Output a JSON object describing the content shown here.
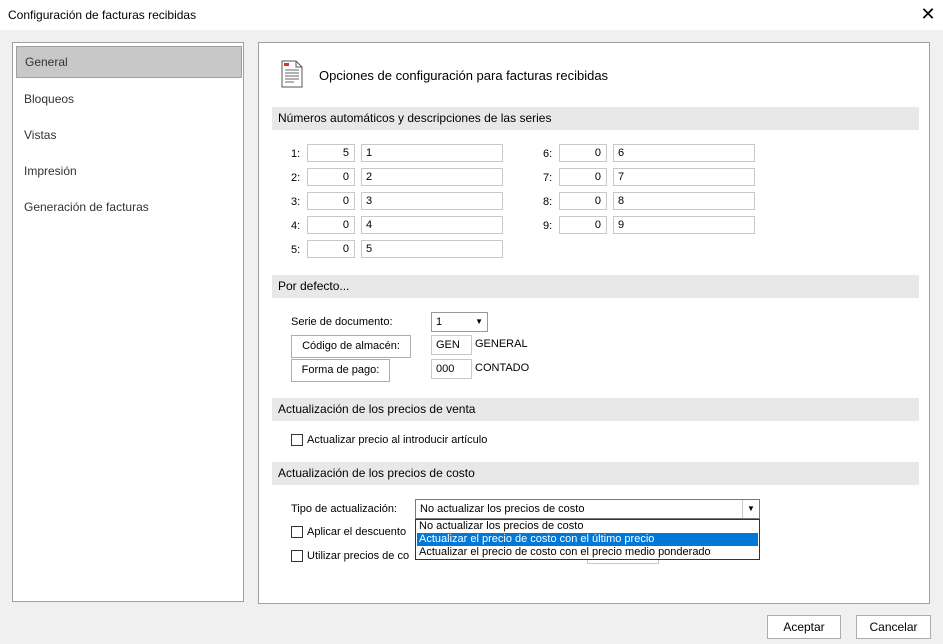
{
  "window": {
    "title": "Configuración de facturas recibidas"
  },
  "sidebar": {
    "items": [
      {
        "label": "General"
      },
      {
        "label": "Bloqueos"
      },
      {
        "label": "Vistas"
      },
      {
        "label": "Impresión"
      },
      {
        "label": "Generación de facturas"
      }
    ]
  },
  "main": {
    "heading": "Opciones de configuración para facturas recibidas"
  },
  "series": {
    "title": "Números automáticos y descripciones de las series",
    "rows": [
      {
        "label": "1:",
        "number": "5",
        "desc": "1"
      },
      {
        "label": "2:",
        "number": "0",
        "desc": "2"
      },
      {
        "label": "3:",
        "number": "0",
        "desc": "3"
      },
      {
        "label": "4:",
        "number": "0",
        "desc": "4"
      },
      {
        "label": "5:",
        "number": "0",
        "desc": "5"
      },
      {
        "label": "6:",
        "number": "0",
        "desc": "6"
      },
      {
        "label": "7:",
        "number": "0",
        "desc": "7"
      },
      {
        "label": "8:",
        "number": "0",
        "desc": "8"
      },
      {
        "label": "9:",
        "number": "0",
        "desc": "9"
      }
    ]
  },
  "defaults": {
    "title": "Por defecto...",
    "serie_label": "Serie de documento:",
    "serie_value": "1",
    "almacen_button": "Código de almacén:",
    "almacen_code": "GEN",
    "almacen_name": "GENERAL",
    "pago_button": "Forma de pago:",
    "pago_code": "000",
    "pago_name": "CONTADO"
  },
  "venta": {
    "title": "Actualización de los precios de venta",
    "checkbox_label": "Actualizar precio al introducir artículo"
  },
  "costo": {
    "title": "Actualización de los precios de costo",
    "tipo_label": "Tipo de actualización:",
    "tipo_value": "No actualizar los precios de costo",
    "options": [
      "No actualizar los precios de costo",
      "Actualizar el precio de costo con el último precio",
      "Actualizar el precio de costo con el precio medio ponderado"
    ],
    "descuento_label": "Aplicar el descuento",
    "utilizar_label": "Utilizar precios de co"
  },
  "buttons": {
    "accept": "Aceptar",
    "cancel": "Cancelar"
  },
  "colors": {
    "selection": "#0078d7",
    "section_bg": "#e8e8e8",
    "window_bg": "#f0f0f0"
  }
}
